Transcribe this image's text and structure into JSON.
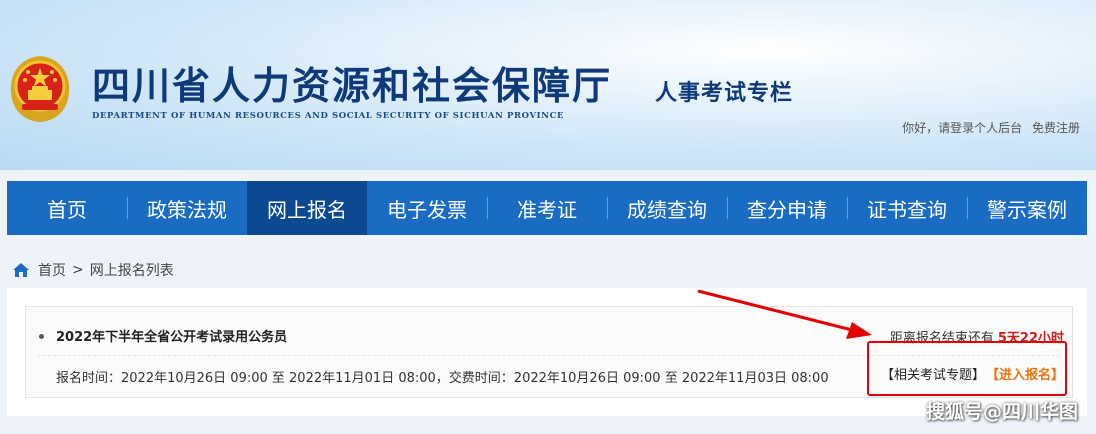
{
  "header": {
    "site_title": "四川省人力资源和社会保障厅",
    "site_subtitle": "DEPARTMENT OF HUMAN RESOURCES AND SOCIAL SECURITY OF SICHUAN PROVINCE",
    "column_title": "人事考试专栏",
    "greeting": "你好，请登录个人后台",
    "register_link": "免费注册"
  },
  "nav": {
    "items": [
      {
        "label": "首页"
      },
      {
        "label": "政策法规"
      },
      {
        "label": "网上报名"
      },
      {
        "label": "电子发票"
      },
      {
        "label": "准考证"
      },
      {
        "label": "成绩查询"
      },
      {
        "label": "查分申请"
      },
      {
        "label": "证书查询"
      },
      {
        "label": "警示案例"
      }
    ],
    "active_index": 2
  },
  "breadcrumb": {
    "home": "首页",
    "separator": ">",
    "current": "网上报名列表"
  },
  "exam": {
    "title": "2022年下半年全省公开考试录用公务员",
    "countdown_label": "距离报名结束还有",
    "countdown_value": "5天22小时",
    "times": "报名时间：2022年10月26日 09:00 至 2022年11月01日 08:00，交费时间：2022年10月26日 09:00 至 2022年11月03日 08:00",
    "special_link": "【相关考试专题】",
    "enter_link": "【进入报名】"
  },
  "watermark": "搜狐号@四川华图",
  "colors": {
    "nav_bg": "#1a6cc3",
    "nav_active": "#0b4a91",
    "countdown": "#d51a1a",
    "enter_link": "#e8750e",
    "annotation": "#e60000"
  }
}
